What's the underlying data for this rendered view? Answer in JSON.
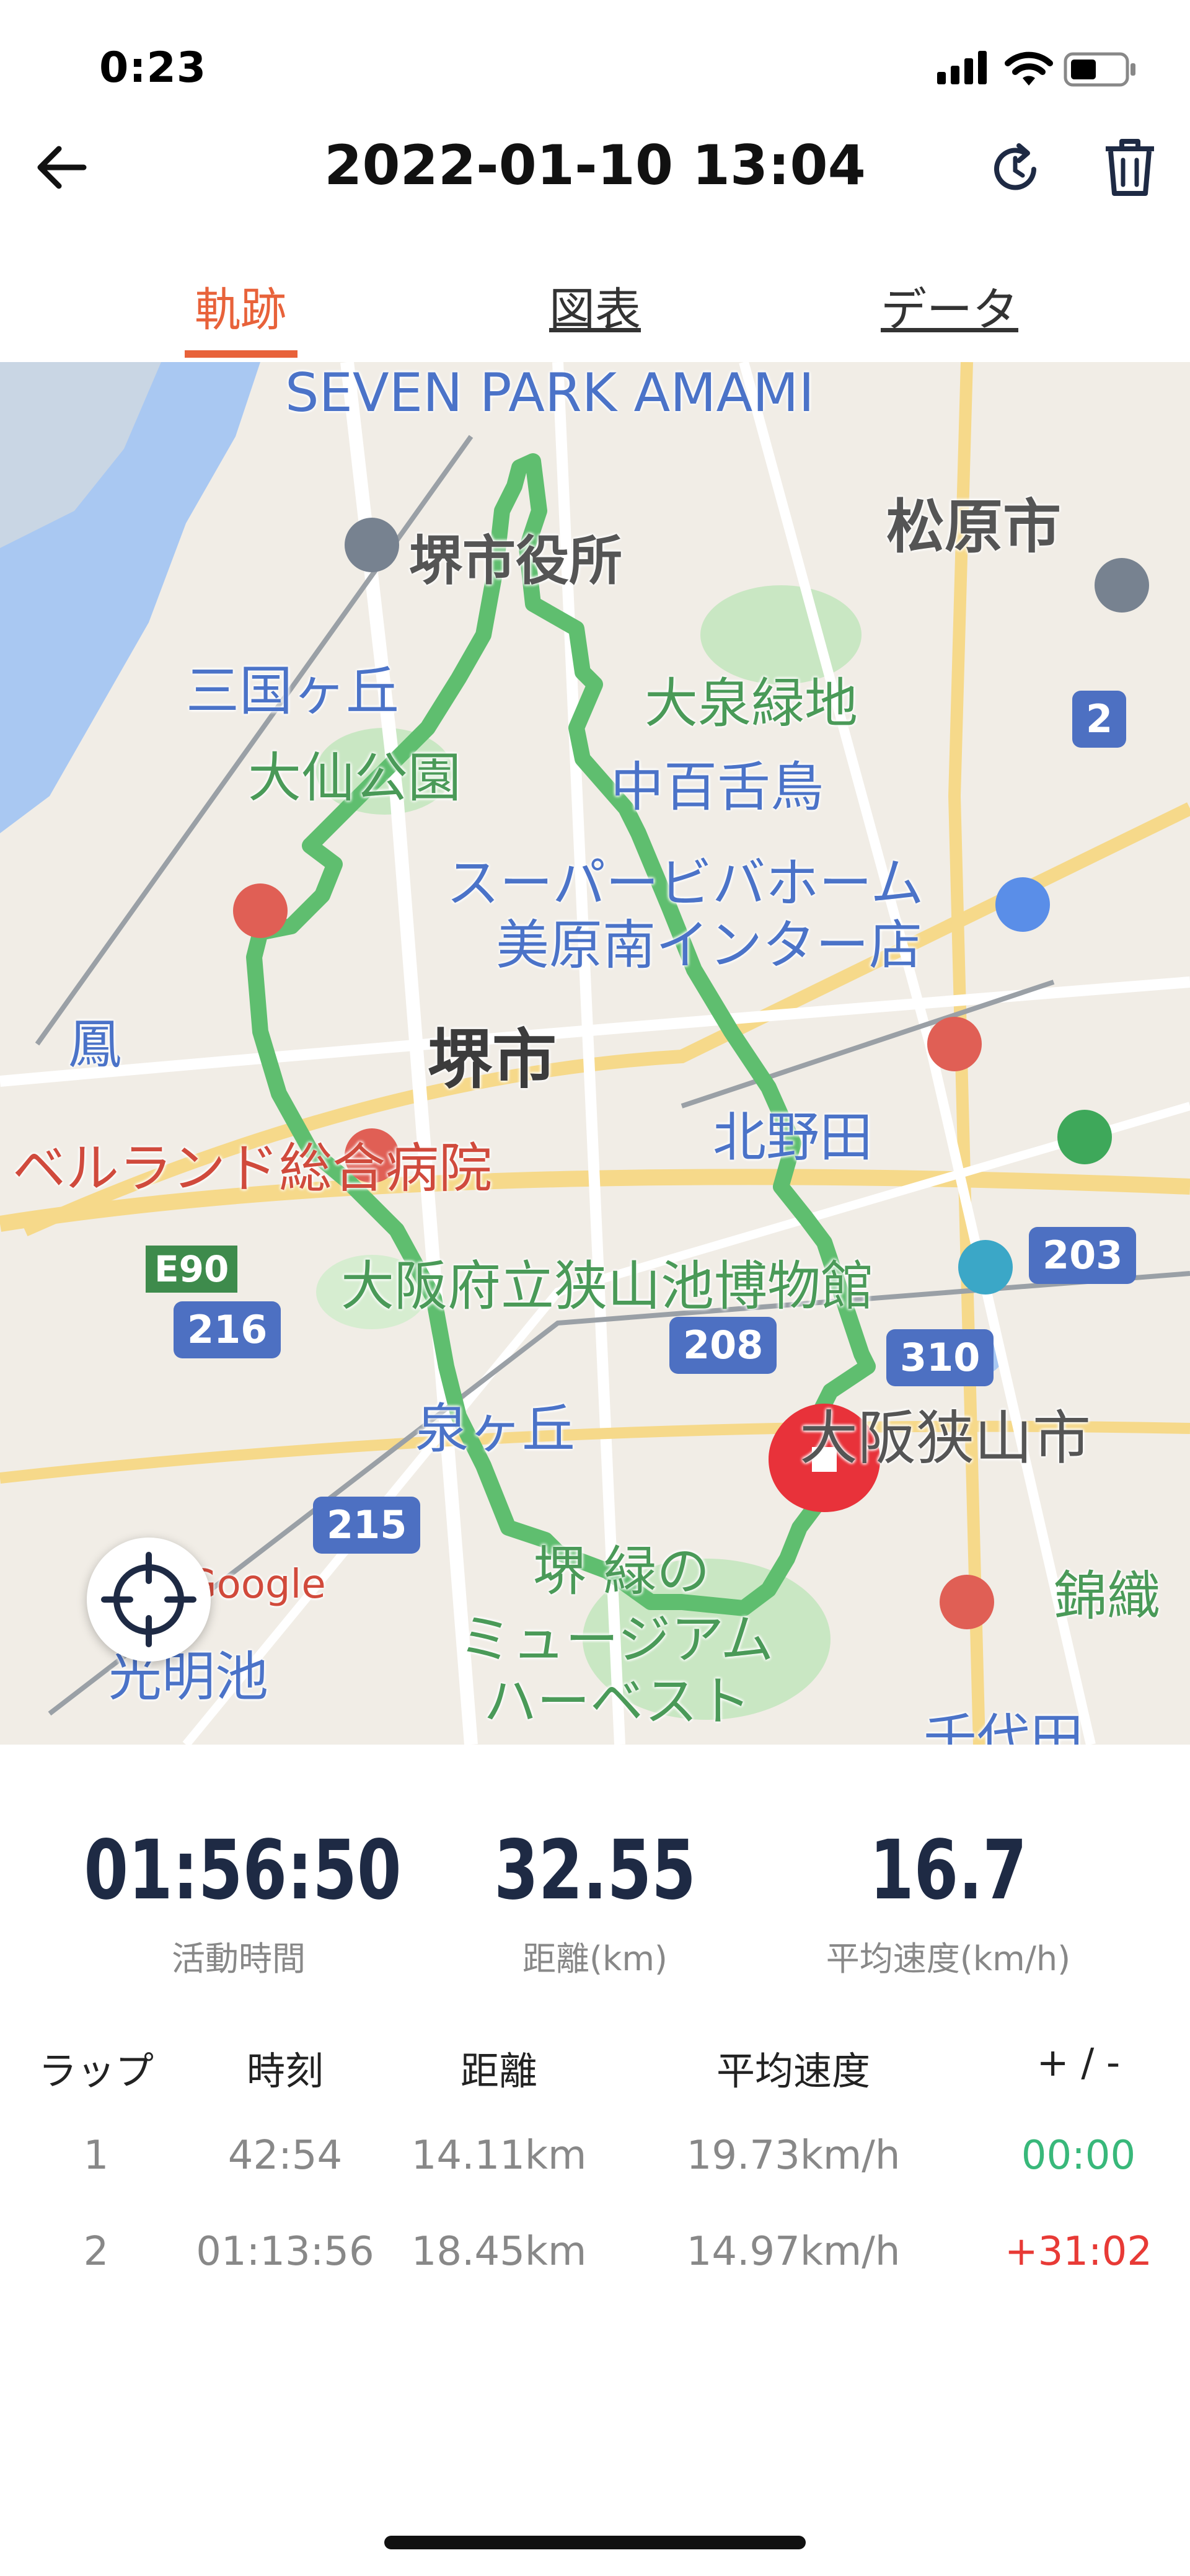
{
  "status_bar": {
    "time": "0:23"
  },
  "header": {
    "title": "2022-01-10 13:04"
  },
  "tabs": [
    {
      "label": "軌跡",
      "active": true
    },
    {
      "label": "図表",
      "active": false
    },
    {
      "label": "データ",
      "active": false
    }
  ],
  "map": {
    "labels": {
      "seven_park": "SEVEN PARK AMAMI",
      "matsubara": "松原市",
      "sakai_city_office": "堺市役所",
      "mikunigaoka": "三国ヶ丘",
      "oizumi_ryokuchi": "大泉緑地",
      "daisen_park": "大仙公園",
      "nakamozu": "中百舌鳥",
      "super_viva_1": "スーパービバホーム",
      "super_viva_2": "美原南インター店",
      "otori": "鳳",
      "sakai": "堺市",
      "kitanoda": "北野田",
      "bellland": "ベルランド総合病院",
      "sayamaike_museum": "大阪府立狭山池博物館",
      "izumigaoka": "泉ヶ丘",
      "osakasayama": "大阪狭山市",
      "sakai_midori_1": "堺 緑の",
      "sakai_midori_2": "ミュージアム",
      "sakai_midori_3": "ハーベスト",
      "komyoike": "光明池",
      "nishikori": "錦織",
      "chiyoda": "千代田",
      "google": "Google"
    },
    "route_shields": [
      "2",
      "203",
      "208",
      "310",
      "216",
      "215"
    ],
    "expressway": "E90"
  },
  "stats": [
    {
      "value": "01:56:50",
      "label": "活動時間"
    },
    {
      "value": "32.55",
      "label": "距離(km)"
    },
    {
      "value": "16.7",
      "label": "平均速度(km/h)"
    }
  ],
  "laps": {
    "headers": [
      "ラップ",
      "時刻",
      "距離",
      "平均速度",
      "+ / -"
    ],
    "rows": [
      {
        "lap": "1",
        "time": "42:54",
        "distance": "14.11km",
        "speed": "19.73km/h",
        "diff": "00:00",
        "diff_color": "#38b87a"
      },
      {
        "lap": "2",
        "time": "01:13:56",
        "distance": "18.45km",
        "speed": "14.97km/h",
        "diff": "+31:02",
        "diff_color": "#e83a36"
      }
    ]
  },
  "colors": {
    "accent": "#e8623a",
    "route": "#5fbe6f",
    "stat_text": "#1e2a44"
  }
}
